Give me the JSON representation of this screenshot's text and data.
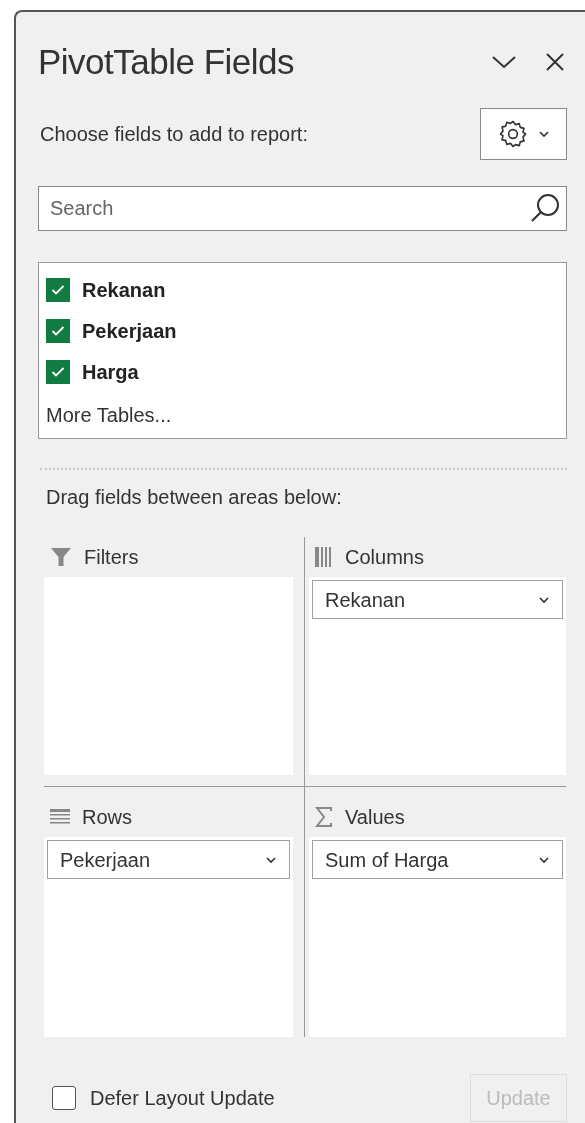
{
  "panel": {
    "title": "PivotTable Fields",
    "subtitle": "Choose fields to add to report:"
  },
  "search": {
    "placeholder": "Search"
  },
  "fields": [
    {
      "label": "Rekanan",
      "checked": true
    },
    {
      "label": "Pekerjaan",
      "checked": true
    },
    {
      "label": "Harga",
      "checked": true
    }
  ],
  "more_tables": "More Tables...",
  "drag_label": "Drag fields between areas below:",
  "areas": [
    {
      "kind": "filters",
      "label": "Filters"
    },
    {
      "kind": "columns",
      "label": "Columns",
      "items": [
        "Rekanan"
      ]
    },
    {
      "kind": "rows",
      "label": "Rows",
      "items": [
        "Pekerjaan"
      ]
    },
    {
      "kind": "values",
      "label": "Values",
      "items": [
        "Sum of Harga"
      ]
    }
  ],
  "defer": {
    "label": "Defer Layout Update",
    "checked": false
  },
  "update_button": {
    "label": "Update",
    "disabled": true
  }
}
